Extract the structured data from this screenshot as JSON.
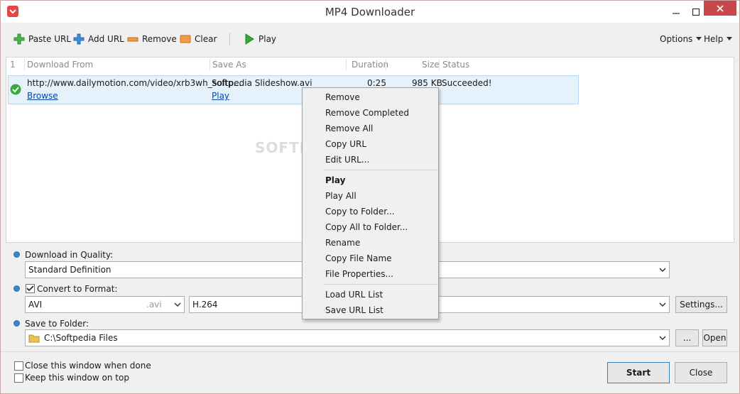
{
  "window": {
    "title": "MP4 Downloader"
  },
  "toolbar": {
    "paste_url": "Paste URL",
    "add_url": "Add URL",
    "remove": "Remove",
    "clear": "Clear",
    "play": "Play",
    "options": "Options",
    "help": "Help"
  },
  "list": {
    "columns": {
      "index": "1",
      "download_from": "Download From",
      "save_as": "Save As",
      "duration": "Duration",
      "size": "Size",
      "status": "Status"
    },
    "rows": [
      {
        "url": "http://www.dailymotion.com/video/xrb3wh_softp...",
        "browse": "Browse",
        "save_as": "Softpedia Slideshow.avi",
        "play": "Play",
        "duration": "0:25",
        "size": "985 KB",
        "status": "Succeeded!"
      }
    ],
    "watermark": "SOFTPEDIA"
  },
  "context_menu": {
    "items_group1": [
      "Remove",
      "Remove Completed",
      "Remove All",
      "Copy URL",
      "Edit URL..."
    ],
    "items_group2": [
      "Play",
      "Play All",
      "Copy to Folder...",
      "Copy All to Folder...",
      "Rename",
      "Copy File Name",
      "File Properties..."
    ],
    "items_group3": [
      "Load URL List",
      "Save URL List"
    ]
  },
  "settings": {
    "quality_label": "Download in Quality:",
    "quality_value": "Standard Definition",
    "format_label": "Convert to Format:",
    "format_checked": true,
    "format_value": "AVI",
    "format_ext": ".avi",
    "codec_value": "H.264",
    "settings_button": "Settings...",
    "folder_label": "Save to Folder:",
    "folder_value": "C:\\Softpedia Files",
    "browse_button": "...",
    "open_button": "Open"
  },
  "bottom": {
    "close_when_done": "Close this window when done",
    "keep_on_top": "Keep this window on top",
    "start": "Start",
    "close": "Close"
  }
}
